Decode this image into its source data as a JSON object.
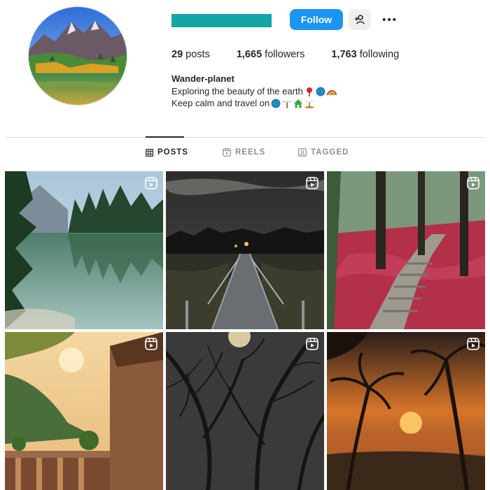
{
  "profile": {
    "display_name": "Wander-planet",
    "bio_line1": "Exploring the beauty of the earth",
    "bio_line2": "Keep calm and travel on",
    "follow_label": "Follow"
  },
  "stats": [
    {
      "value": "29",
      "label": "posts"
    },
    {
      "value": "1,665",
      "label": "followers"
    },
    {
      "value": "1,763",
      "label": "following"
    }
  ],
  "tabs": [
    {
      "label": "POSTS",
      "icon": "grid-icon",
      "active": true
    },
    {
      "label": "REELS",
      "icon": "reels-icon",
      "active": false
    },
    {
      "label": "TAGGED",
      "icon": "tagged-icon",
      "active": false
    }
  ],
  "posts": [
    {
      "scene": "mountain lake with pine trees",
      "type": "reel"
    },
    {
      "scene": "wooden boardwalk at night",
      "type": "reel"
    },
    {
      "scene": "forest path with red leaves",
      "type": "reel"
    },
    {
      "scene": "stone balcony overlooking valley at sunset",
      "type": "reel"
    },
    {
      "scene": "bare trees under full moon",
      "type": "reel"
    },
    {
      "scene": "palm trees at ocean sunset",
      "type": "reel"
    }
  ],
  "colors": {
    "follow_button": "#1a95f3",
    "redacted_username": "#11a7a7",
    "text": "#262626",
    "muted": "#8e8e8e"
  }
}
